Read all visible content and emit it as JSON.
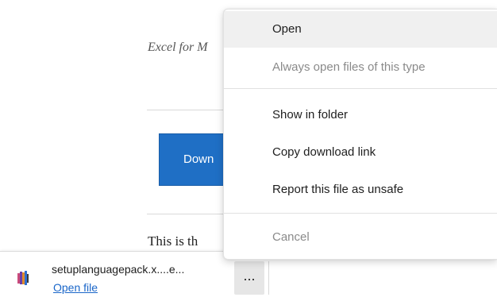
{
  "page": {
    "excel_text": "Excel for M",
    "download_button_label": "Down",
    "body_text": "This is th"
  },
  "download_bar": {
    "file_name": "setuplanguagepack.x....e...",
    "open_file_label": "Open file",
    "more_label": "...",
    "icon": "installer-file-icon"
  },
  "context_menu": {
    "items": [
      {
        "label": "Open",
        "state": "hovered"
      },
      {
        "label": "Always open files of this type",
        "state": "disabled"
      },
      {
        "label": "Show in folder",
        "state": "enabled"
      },
      {
        "label": "Copy download link",
        "state": "enabled"
      },
      {
        "label": "Report this file as unsafe",
        "state": "enabled"
      },
      {
        "label": "Cancel",
        "state": "disabled"
      }
    ]
  },
  "colors": {
    "accent_button": "#1f6fc5",
    "link": "#1a66c9",
    "disabled_text": "#8a8a8a",
    "hover_bg": "#f0f0f0"
  }
}
